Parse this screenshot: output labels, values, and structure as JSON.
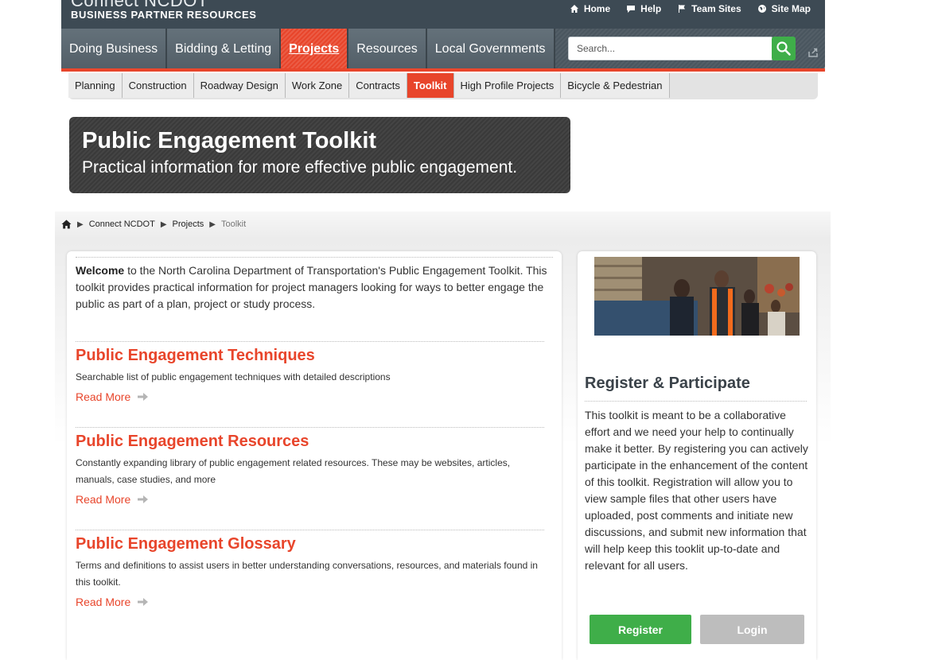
{
  "header": {
    "logo_line1": "Connect NCDOT",
    "logo_line2": "BUSINESS PARTNER RESOURCES",
    "toplinks": [
      {
        "label": "Home",
        "icon": "home-icon"
      },
      {
        "label": "Help",
        "icon": "help-bubble-icon"
      },
      {
        "label": "Team Sites",
        "icon": "flag-icon"
      },
      {
        "label": "Site Map",
        "icon": "globe-icon"
      }
    ]
  },
  "mainnav": {
    "items": [
      {
        "label": "Doing Business"
      },
      {
        "label": "Bidding & Letting"
      },
      {
        "label": "Projects",
        "active": true
      },
      {
        "label": "Resources"
      },
      {
        "label": "Local Governments"
      }
    ],
    "search_placeholder": "Search..."
  },
  "subnav": {
    "items": [
      {
        "label": "Planning"
      },
      {
        "label": "Construction"
      },
      {
        "label": "Roadway Design"
      },
      {
        "label": "Work Zone"
      },
      {
        "label": "Contracts"
      },
      {
        "label": "Toolkit",
        "active": true
      },
      {
        "label": "High Profile Projects"
      },
      {
        "label": "Bicycle & Pedestrian"
      }
    ]
  },
  "banner": {
    "title": "Public Engagement Toolkit",
    "subtitle": "Practical information for more effective public engagement."
  },
  "breadcrumb": {
    "items": [
      "Connect NCDOT",
      "Projects",
      "Toolkit"
    ]
  },
  "welcome": {
    "bold": "Welcome",
    "text": " to the North Carolina Department of Transportation's Public Engagement Toolkit. This toolkit provides practical information for project managers looking for ways to better engage the public as part of a plan, project or study process."
  },
  "sections": [
    {
      "title": "Public Engagement Techniques",
      "description": "Searchable list of public engagement techniques with detailed descriptions",
      "read_more": "Read More"
    },
    {
      "title": "Public Engagement Resources",
      "description": "Constantly expanding library of public engagement related resources. These may be websites, articles, manuals, case studies, and more",
      "read_more": "Read More"
    },
    {
      "title": "Public Engagement Glossary",
      "description": "Terms and definitions to assist users in better understanding conversations, resources, and materials found in this toolkit.",
      "read_more": "Read More"
    }
  ],
  "sidebar": {
    "title": "Register & Participate",
    "text": "This toolkit is meant to be a collaborative effort and we need your help to continually make it better. By registering you can actively participate in the enhancement of the content of this toolkit. Registration will allow you to view sample files that other users have uploaded, post comments and initiate new discussions, and submit new information that will help keep this tooklit up-to-date and relevant for all users.",
    "register_label": "Register",
    "login_label": "Login"
  },
  "colors": {
    "accent": "#e8452b",
    "nav_bg": "#4a565f",
    "green": "#3fae49"
  }
}
